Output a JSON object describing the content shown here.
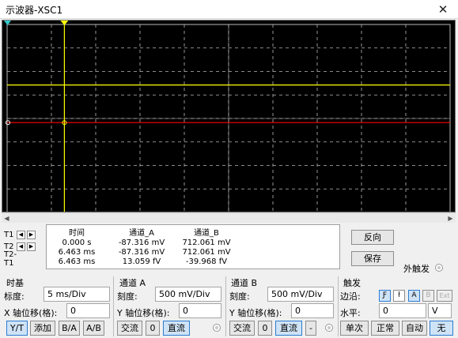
{
  "window": {
    "title": "示波器-XSC1"
  },
  "cursors": {
    "rows": [
      {
        "label": "T1"
      },
      {
        "label": "T2"
      },
      {
        "label": "T2-T1"
      }
    ]
  },
  "readout": {
    "headers": [
      "时间",
      "通道_A",
      "通道_B"
    ],
    "rows": [
      [
        "0.000 s",
        "-87.316 mV",
        "712.061 mV"
      ],
      [
        "6.463 ms",
        "-87.316 mV",
        "712.061 mV"
      ],
      [
        "6.463 ms",
        "13.059 fV",
        "-39.968 fV"
      ]
    ]
  },
  "buttons": {
    "reverse": "反向",
    "save": "保存",
    "ext_trigger": "外触发"
  },
  "timebase": {
    "title": "时基",
    "scale_label": "标度:",
    "scale_value": "5 ms/Div",
    "xpos_label": "X 轴位移(格):",
    "xpos_value": "0",
    "modes": [
      "Y/T",
      "添加",
      "B/A",
      "A/B"
    ]
  },
  "channel_a": {
    "title": "通道 A",
    "scale_label": "刻度:",
    "scale_value": "500 mV/Div",
    "ypos_label": "Y 轴位移(格):",
    "ypos_value": "0",
    "coupling": [
      "交流",
      "0",
      "直流"
    ]
  },
  "channel_b": {
    "title": "通道 B",
    "scale_label": "刻度:",
    "scale_value": "500 mV/Div",
    "ypos_label": "Y 轴位移(格):",
    "ypos_value": "0",
    "coupling": [
      "交流",
      "0",
      "直流",
      "-"
    ]
  },
  "trigger": {
    "title": "触发",
    "edge_label": "边沿:",
    "level_label": "水平:",
    "level_value": "0",
    "level_unit": "V",
    "sources": [
      "A",
      "B",
      "Ext"
    ],
    "modes": [
      "单次",
      "正常",
      "自动",
      "无"
    ]
  },
  "colors": {
    "screen_bg": "#000000",
    "grid": "#b9b9b9",
    "channel_a": "#ff0000",
    "channel_b": "#ffff00",
    "cursor": "#ffff00",
    "selected": "#2b7cd3"
  },
  "icons": [
    "close-icon",
    "left-arrow-icon",
    "right-arrow-icon",
    "rising-edge-icon",
    "falling-edge-icon"
  ]
}
